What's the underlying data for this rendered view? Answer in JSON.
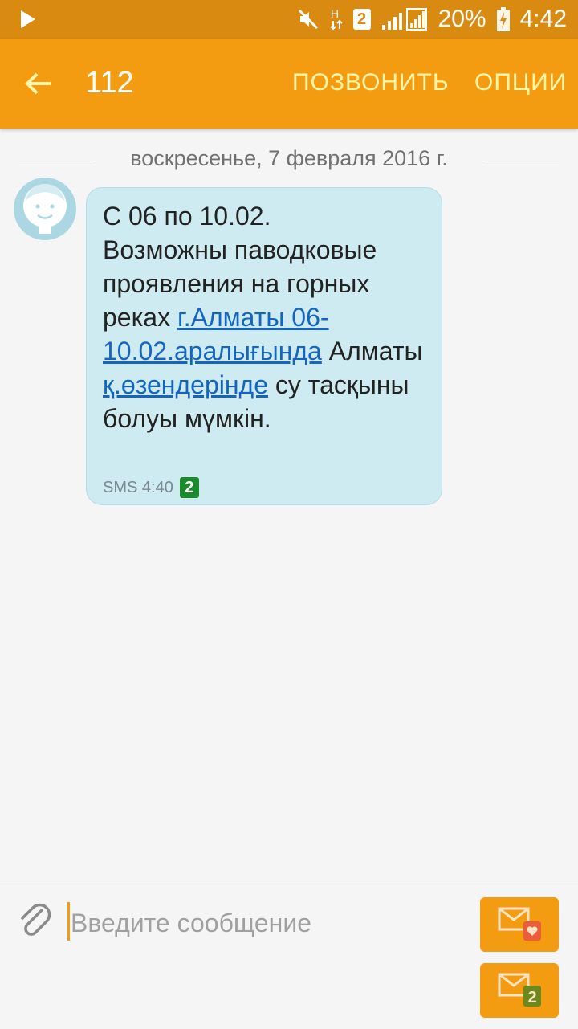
{
  "status_bar": {
    "network_label": "H",
    "sim_slot": "2",
    "battery": "20%",
    "time": "4:42"
  },
  "app_bar": {
    "title": "112",
    "call_label": "ПОЗВОНИТЬ",
    "options_label": "ОПЦИИ"
  },
  "conversation": {
    "date_separator": "воскресенье, 7 февраля 2016 г.",
    "message": {
      "line1": "С 06 по 10.02.",
      "line2": "Возможны паводковые проявления на горных реках ",
      "link1": "г.Алматы 06-10.02.аралығында",
      "line3": " Алматы ",
      "link2": "қ.өзендерінде",
      "line4": " су тасқыны болуы мүмкін.",
      "meta": "SMS 4:40",
      "sim": "2"
    }
  },
  "composer": {
    "placeholder": "Введите сообщение",
    "send_sim_badge": "2"
  },
  "colors": {
    "status_bar": "#d98a10",
    "app_bar": "#f39c12",
    "bubble": "#cdebf0",
    "link": "#1565c0"
  }
}
